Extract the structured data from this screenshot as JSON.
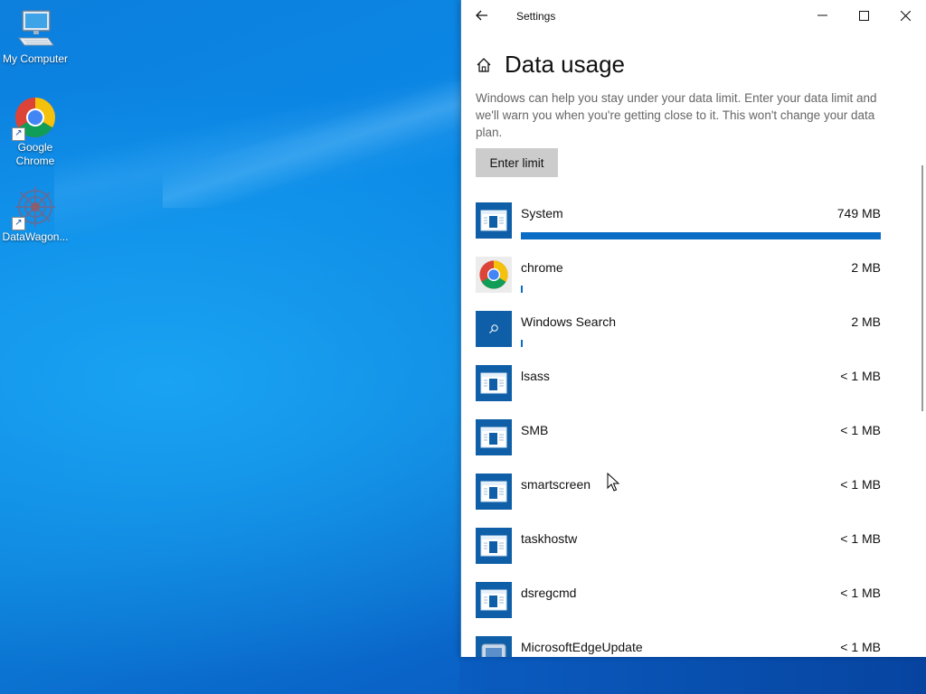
{
  "desktop": {
    "icons": [
      {
        "label": "My Computer",
        "icon": "computer-icon"
      },
      {
        "label": "Google Chrome",
        "icon": "chrome-icon"
      },
      {
        "label": "DataWagon...",
        "icon": "datawagon-icon"
      }
    ]
  },
  "window": {
    "title": "Settings",
    "back_icon": "back-arrow-icon",
    "controls": [
      "minimize-icon",
      "maximize-icon",
      "close-icon"
    ]
  },
  "page": {
    "title": "Data usage",
    "home_icon": "home-icon",
    "description": "Windows can help you stay under your data limit. Enter your data limit and we'll warn you when you're getting close to it. This won't change your data plan.",
    "enter_limit_label": "Enter limit"
  },
  "apps": [
    {
      "name": "System",
      "usage": "749 MB",
      "fraction": 1.0,
      "icon": "system-app-icon"
    },
    {
      "name": "chrome",
      "usage": "2 MB",
      "fraction": 0.003,
      "icon": "chrome-icon"
    },
    {
      "name": "Windows Search",
      "usage": "2 MB",
      "fraction": 0.003,
      "icon": "search-icon"
    },
    {
      "name": "lsass",
      "usage": "< 1 MB",
      "fraction": 0,
      "icon": "system-app-icon"
    },
    {
      "name": "SMB",
      "usage": "< 1 MB",
      "fraction": 0,
      "icon": "system-app-icon"
    },
    {
      "name": "smartscreen",
      "usage": "< 1 MB",
      "fraction": 0,
      "icon": "system-app-icon"
    },
    {
      "name": "taskhostw",
      "usage": "< 1 MB",
      "fraction": 0,
      "icon": "system-app-icon"
    },
    {
      "name": "dsregcmd",
      "usage": "< 1 MB",
      "fraction": 0,
      "icon": "system-app-icon"
    },
    {
      "name": "MicrosoftEdgeUpdate",
      "usage": "< 1 MB",
      "fraction": 0,
      "icon": "edge-update-icon"
    }
  ],
  "colors": {
    "accent": "#0a6cc4",
    "app_tile": "#0f5fa8",
    "button_bg": "#cccccc"
  }
}
